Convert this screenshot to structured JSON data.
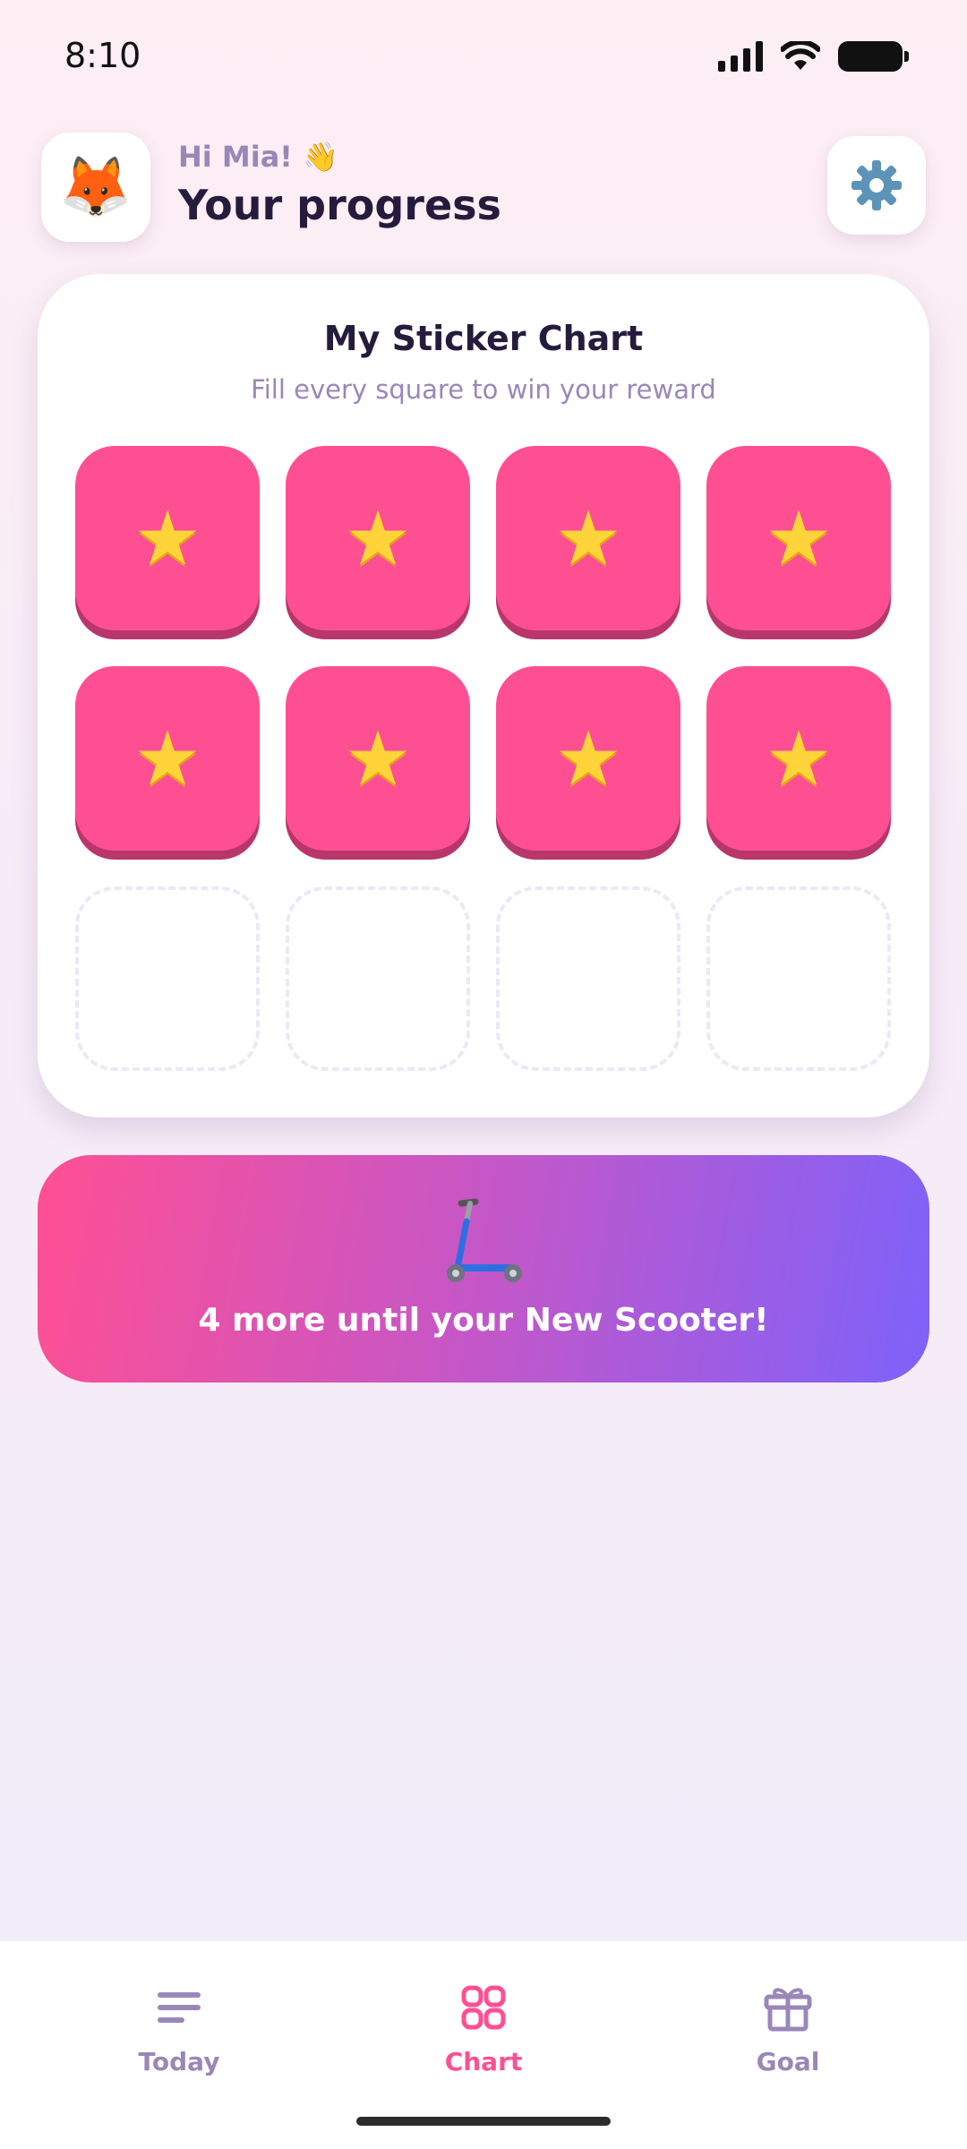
{
  "status_bar": {
    "time": "8:10"
  },
  "header": {
    "avatar_emoji": "🦊",
    "greeting": "Hi Mia! 👋",
    "title": "Your progress",
    "settings_icon": "gear-icon"
  },
  "sticker_chart": {
    "title": "My Sticker Chart",
    "subtitle": "Fill every square to win your reward",
    "total_squares": 12,
    "filled_squares": 8,
    "sticker_symbol": "★"
  },
  "reward": {
    "icon": "scooter-icon",
    "message": "4 more until your New Scooter!"
  },
  "nav": {
    "items": [
      {
        "label": "Today",
        "icon": "list-icon"
      },
      {
        "label": "Chart",
        "icon": "grid-icon",
        "active": true
      },
      {
        "label": "Goal",
        "icon": "gift-icon"
      }
    ]
  },
  "colors": {
    "sticker": "#ff4f93",
    "star": "#ffd43a",
    "accent": "#ff4f93",
    "muted": "#9a87b8"
  }
}
